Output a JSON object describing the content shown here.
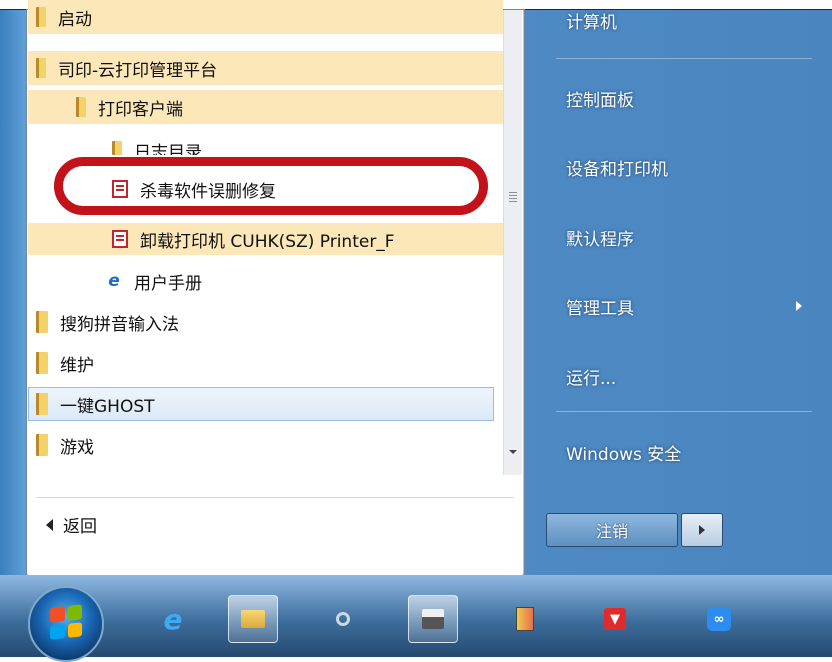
{
  "programs": {
    "items": [
      {
        "label": "启动",
        "type": "folder"
      },
      {
        "label": "司印-云打印管理平台",
        "type": "folder"
      },
      {
        "label": "打印客户端",
        "type": "folder"
      },
      {
        "label": "日志目录",
        "type": "folder"
      },
      {
        "label": "杀毒软件误删修复",
        "type": "app"
      },
      {
        "label": "卸载打印机 CUHK(SZ) Printer_F",
        "type": "app"
      },
      {
        "label": "用户手册",
        "type": "ie"
      },
      {
        "label": "搜狗拼音输入法",
        "type": "folder"
      },
      {
        "label": "维护",
        "type": "folder"
      },
      {
        "label": "一键GHOST",
        "type": "folder"
      },
      {
        "label": "游戏",
        "type": "folder"
      }
    ],
    "back_label": "返回"
  },
  "right_panel": {
    "items": [
      "计算机",
      "控制面板",
      "设备和打印机",
      "默认程序",
      "管理工具",
      "运行...",
      "Windows 安全"
    ],
    "logoff_label": "注销"
  },
  "taskbar": {
    "icons": [
      "ie-icon",
      "explorer-icon",
      "search-icon",
      "printer-icon",
      "app-icon",
      "antivirus-icon",
      "cloud-icon"
    ]
  },
  "colors": {
    "highlight": "#fbe7b8",
    "annotation_circle": "#c2121c",
    "frame_blue": "#4f8bc5"
  }
}
